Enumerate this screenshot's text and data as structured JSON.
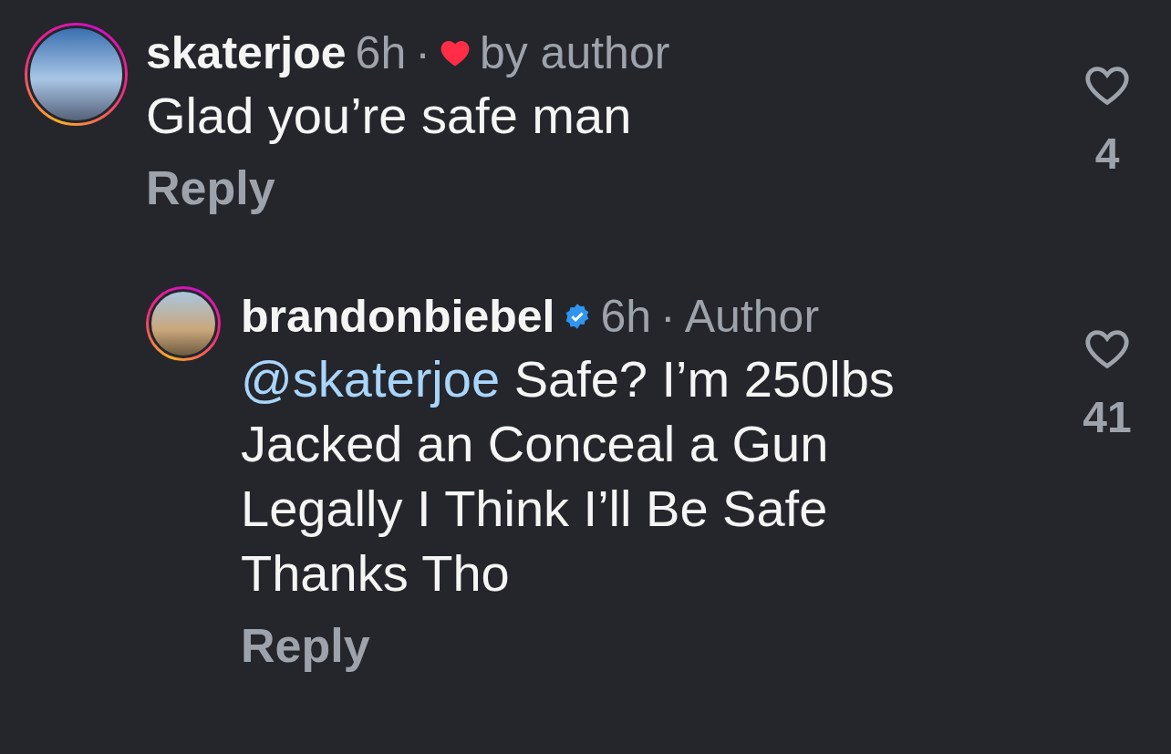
{
  "comments": [
    {
      "username": "skaterjoe",
      "verified": false,
      "time": "6h",
      "separator": "·",
      "liked_by_author": true,
      "author_note": "by author",
      "text": "Glad you’re safe man",
      "reply": "Reply",
      "liked": false,
      "likes": "4",
      "children": [
        {
          "username": "brandonbiebel",
          "verified": true,
          "time": "6h",
          "separator": "·",
          "liked_by_author": false,
          "author_note": "Author",
          "mention": "@skaterjoe",
          "text": "Safe? I’m 250lbs Jacked an Conceal a Gun Legally I Think I’ll Be Safe Thanks Tho",
          "reply": "Reply",
          "liked": false,
          "likes": "41"
        }
      ]
    }
  ]
}
